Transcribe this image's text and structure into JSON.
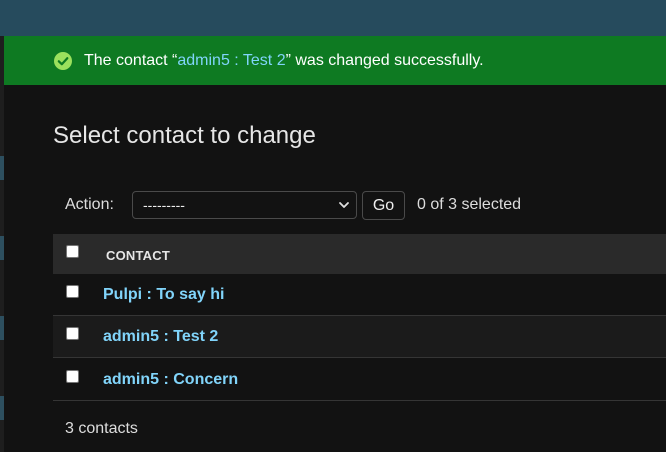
{
  "messages": {
    "success": {
      "prefix": "The contact “",
      "link": "admin5 : Test 2",
      "suffix": "” was changed successfully.",
      "icon": "check-circle-icon",
      "color": "#0e7a22"
    }
  },
  "page": {
    "title": "Select contact to change"
  },
  "actions": {
    "label": "Action:",
    "select_value": "---------",
    "go_label": "Go",
    "selected_text": "0 of 3 selected"
  },
  "table": {
    "header": "CONTACT",
    "rows": [
      {
        "label": "Pulpi : To say hi"
      },
      {
        "label": "admin5 : Test 2"
      },
      {
        "label": "admin5 : Concern"
      }
    ]
  },
  "footer": {
    "count": "3 contacts"
  },
  "colors": {
    "link": "#81d4fa",
    "header_bar": "#264b5d",
    "background": "#121212"
  }
}
